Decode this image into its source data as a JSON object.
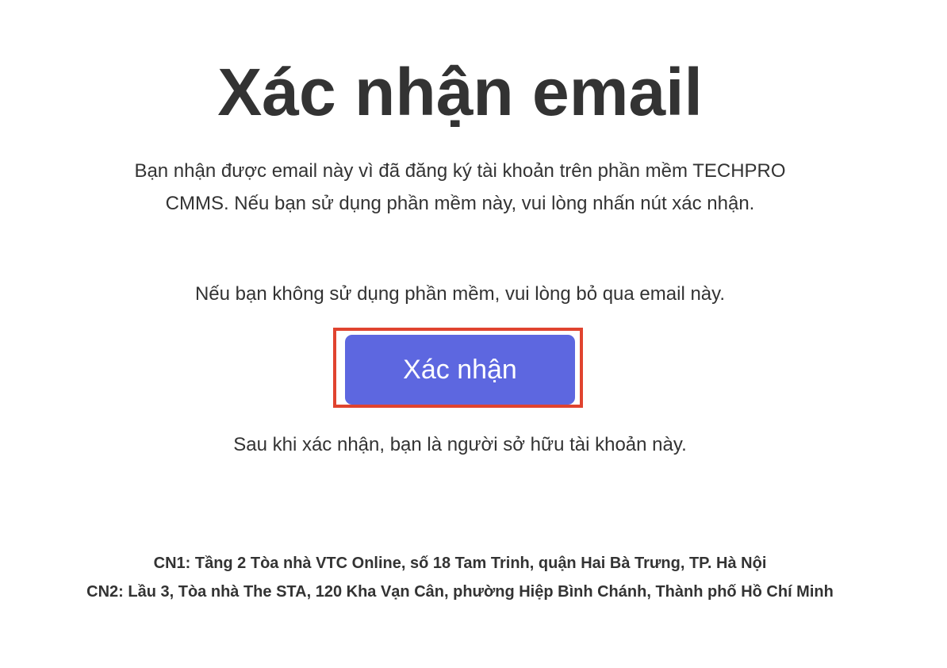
{
  "email": {
    "title": "Xác nhận email",
    "intro": "Bạn nhận được email này vì đã đăng ký tài khoản trên phần mềm TECHPRO CMMS. Nếu bạn sử dụng phần mềm này, vui lòng nhấn nút xác nhận.",
    "ignore_note": "Nếu bạn không sử dụng phần mềm, vui lòng bỏ qua email này.",
    "confirm_button": "Xác nhận",
    "after_note": "Sau khi xác nhận, bạn là người sở hữu tài khoản này.",
    "highlight_color": "#e0432f",
    "button_color": "#5d67e0"
  },
  "footer": {
    "branch1": "CN1: Tầng 2 Tòa nhà VTC Online, số 18 Tam Trinh, quận Hai Bà Trưng, TP. Hà Nội",
    "branch2": "CN2: Lầu 3, Tòa nhà The STA, 120 Kha Vạn Cân, phường Hiệp Bình Chánh, Thành phố Hồ Chí Minh"
  }
}
